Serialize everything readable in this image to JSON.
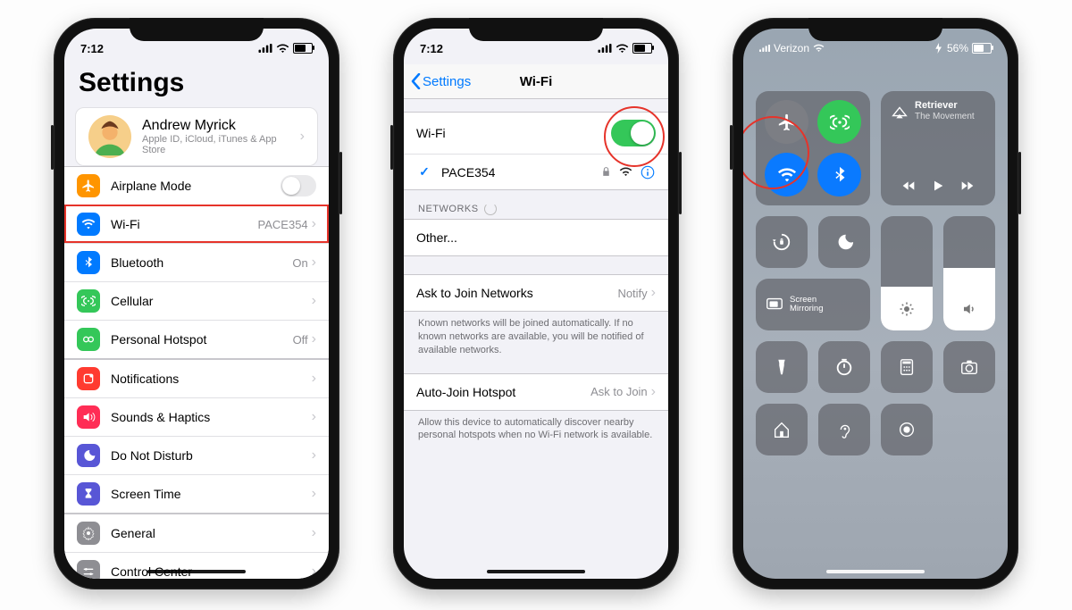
{
  "phone1": {
    "status": {
      "time": "7:12"
    },
    "title": "Settings",
    "profile": {
      "name": "Andrew Myrick",
      "sub": "Apple ID, iCloud, iTunes & App Store"
    },
    "group1": {
      "airplane": {
        "label": "Airplane Mode"
      },
      "wifi": {
        "label": "Wi-Fi",
        "value": "PACE354"
      },
      "bluetooth": {
        "label": "Bluetooth",
        "value": "On"
      },
      "cellular": {
        "label": "Cellular"
      },
      "hotspot": {
        "label": "Personal Hotspot",
        "value": "Off"
      }
    },
    "group2": {
      "notifications": {
        "label": "Notifications"
      },
      "sounds": {
        "label": "Sounds & Haptics"
      },
      "dnd": {
        "label": "Do Not Disturb"
      },
      "screentime": {
        "label": "Screen Time"
      }
    },
    "group3": {
      "general": {
        "label": "General"
      },
      "controlcenter": {
        "label": "Control Center"
      }
    }
  },
  "phone2": {
    "status": {
      "time": "7:12"
    },
    "nav": {
      "back": "Settings",
      "title": "Wi-Fi"
    },
    "wifi_cell": {
      "label": "Wi-Fi"
    },
    "connected": {
      "name": "PACE354"
    },
    "networks_header": "NETWORKS",
    "other": "Other...",
    "ask": {
      "label": "Ask to Join Networks",
      "value": "Notify"
    },
    "ask_footer": "Known networks will be joined automatically. If no known networks are available, you will be notified of available networks.",
    "autojoin": {
      "label": "Auto-Join Hotspot",
      "value": "Ask to Join"
    },
    "autojoin_footer": "Allow this device to automatically discover nearby personal hotspots when no Wi-Fi network is available."
  },
  "phone3": {
    "status": {
      "carrier": "Verizon",
      "battery_pct": "56%"
    },
    "music": {
      "song": "Retriever",
      "artist": "The Movement"
    },
    "screen_mirror": "Screen\nMirroring"
  }
}
